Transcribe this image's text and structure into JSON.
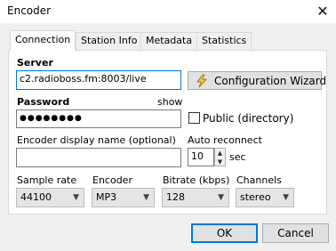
{
  "window": {
    "title": "Encoder",
    "close_icon": "✕"
  },
  "tabs": [
    "Connection",
    "Station Info",
    "Metadata",
    "Statistics"
  ],
  "server": {
    "label": "Server",
    "value": "c2.radioboss.fm:8003/live",
    "wizard_button": "Configuration Wizard"
  },
  "password": {
    "label": "Password",
    "show_link": "show",
    "value": "●●●●●●●●",
    "public_label": "Public (directory)"
  },
  "encoder_display": {
    "label": "Encoder display name (optional)",
    "value": ""
  },
  "auto_reconnect": {
    "label": "Auto reconnect",
    "value": "10",
    "unit": "sec"
  },
  "sample_rate": {
    "label": "Sample rate",
    "value": "44100"
  },
  "encoder": {
    "label": "Encoder",
    "value": "MP3"
  },
  "bitrate": {
    "label": "Bitrate (kbps)",
    "value": "128"
  },
  "channels": {
    "label": "Channels",
    "value": "stereo"
  },
  "buttons": {
    "ok": "OK",
    "cancel": "Cancel"
  },
  "colors": {
    "accent": "#0078d7",
    "dialog_bg": "#f0f0f0",
    "wizard_icon": "#d4a017"
  }
}
